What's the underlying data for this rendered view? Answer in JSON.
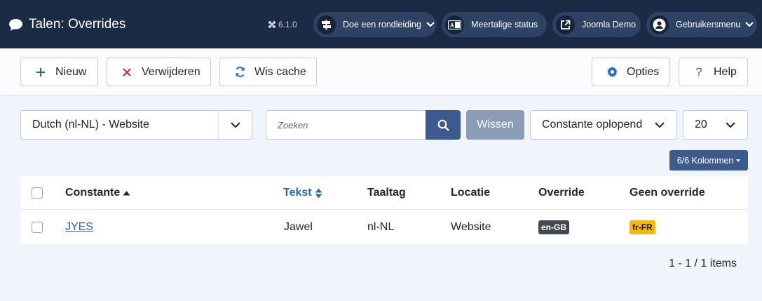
{
  "header": {
    "title": "Talen: Overrides",
    "version": "6.1.0",
    "pills": [
      {
        "label": "Doe een rondleiding",
        "icon": "signpost-icon"
      },
      {
        "label": "Meertalige status",
        "icon": "language-icon"
      },
      {
        "label": "Joomla Demo",
        "icon": "external-link-icon"
      },
      {
        "label": "Gebruikersmenu",
        "icon": "user-circle-icon"
      }
    ]
  },
  "toolbar": {
    "new_label": "Nieuw",
    "delete_label": "Verwijderen",
    "clear_cache_label": "Wis cache",
    "options_label": "Opties",
    "help_label": "Help"
  },
  "filters": {
    "language_selected": "Dutch (nl-NL) - Website",
    "search_placeholder": "Zoeken",
    "clear_label": "Wissen",
    "ordering_selected": "Constante oplopend",
    "limit_selected": "20",
    "columns_label": "6/6 Kolommen"
  },
  "table": {
    "headers": {
      "constant": "Constante",
      "text": "Tekst",
      "langtag": "Taaltag",
      "location": "Locatie",
      "override": "Override",
      "no_override": "Geen override"
    },
    "rows": [
      {
        "constant": "JYES",
        "text": "Jawel",
        "langtag": "nl-NL",
        "location": "Website",
        "override": "en-GB",
        "no_override": "fr-FR"
      }
    ]
  },
  "pagination": {
    "summary": "1 - 1 / 1 items"
  },
  "colors": {
    "header_bg": "#1c2b45",
    "primary": "#3c5a8e",
    "link": "#2a64ad",
    "warning": "#f5b80c"
  }
}
